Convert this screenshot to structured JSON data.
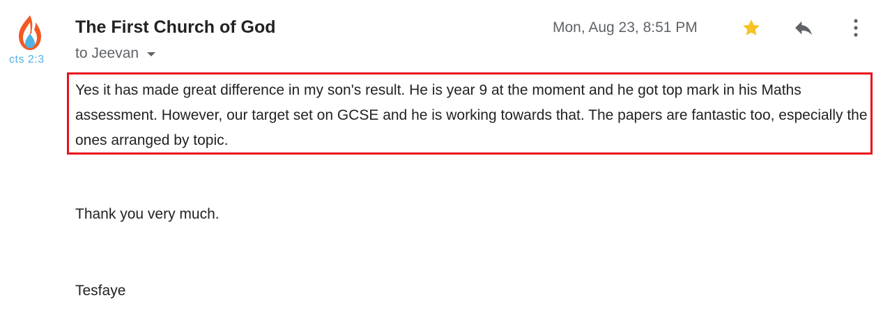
{
  "email": {
    "sender": "The First Church of God",
    "recipient": "to Jeevan",
    "date": "Mon, Aug 23, 8:51 PM",
    "avatar_text": "cts 2:3",
    "body": "Yes it has made great difference in my son's result. He is year 9 at the moment and he got top mark in his Maths assessment. However, our target set on GCSE and he is working towards that. The papers are fantastic too, especially the ones arranged by topic.",
    "thanks": "Thank you very much.",
    "signature": "Tesfaye"
  },
  "icons": {
    "star": "star-icon",
    "reply": "reply-icon",
    "more": "more-vert-icon",
    "recipient_toggle": "caret-down-icon"
  },
  "colors": {
    "highlight_border": "#e8121c",
    "star": "#f7c325",
    "flame_orange": "#f15a24",
    "drop_blue": "#4fb3e6",
    "muted_text": "#5f6368"
  }
}
